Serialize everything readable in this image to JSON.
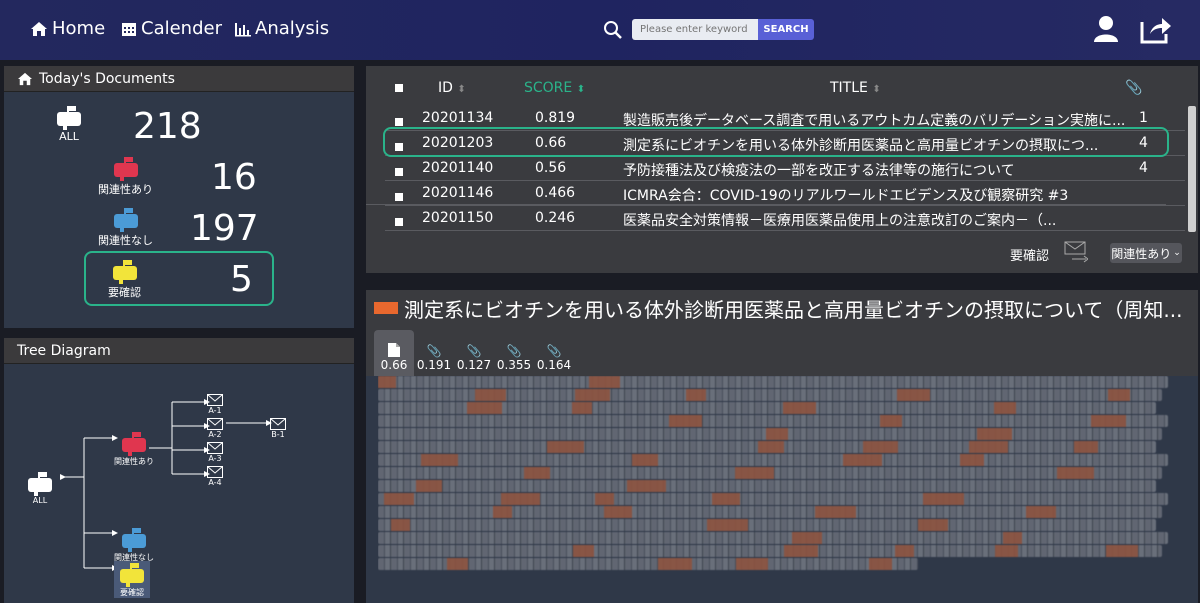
{
  "nav": {
    "home": "Home",
    "calendar": "Calender",
    "analysis": "Analysis"
  },
  "search": {
    "placeholder": "Please enter keyword",
    "button": "SEARCH"
  },
  "today": {
    "title": "Today's Documents",
    "all_label": "ALL",
    "all_count": "218",
    "related_label": "関連性あり",
    "related_count": "16",
    "unrelated_label": "関連性なし",
    "unrelated_count": "197",
    "check_label": "要確認",
    "check_count": "5"
  },
  "tree": {
    "title": "Tree Diagram",
    "all": "ALL",
    "related": "関連性あり",
    "unrelated": "関連性なし",
    "check": "要確認",
    "a1": "A-1",
    "a2": "A-2",
    "a3": "A-3",
    "a4": "A-4",
    "b1": "B-1"
  },
  "table": {
    "headers": {
      "id": "ID",
      "score": "SCORE",
      "title": "TITLE"
    },
    "rows": [
      {
        "id": "20201134",
        "score": "0.819",
        "title": "製造販売後データベース調査で用いるアウトカム定義のバリデーション実施に...",
        "att": "1"
      },
      {
        "id": "20201203",
        "score": "0.66",
        "title": "測定系にビオチンを用いる体外診断用医薬品と高用量ビオチンの摂取につ...",
        "att": "4"
      },
      {
        "id": "20201140",
        "score": "0.56",
        "title": "予防接種法及び検疫法の一部を改正する法律等の施行について",
        "att": "4"
      },
      {
        "id": "20201146",
        "score": "0.466",
        "title": "ICMRA会合：COVID-19のリアルワールドエビデンス及び観察研究 #3",
        "att": ""
      },
      {
        "id": "20201150",
        "score": "0.246",
        "title": "医薬品安全対策情報－医療用医薬品使用上の注意改訂のご案内－（...",
        "att": ""
      }
    ],
    "footer_label": "要確認",
    "select_value": "関連性あり"
  },
  "detail": {
    "title": "測定系にビオチンを用いる体外診断用医薬品と高用量ビオチンの摂取について（周知...",
    "tabs": [
      "0.66",
      "0.191",
      "0.127",
      "0.355",
      "0.164"
    ]
  },
  "colors": {
    "accent": "#2ab38a",
    "related": "#e0364f",
    "unrelated": "#4b9bd6",
    "check": "#f2e43a",
    "highlight": "#d96a3a"
  }
}
